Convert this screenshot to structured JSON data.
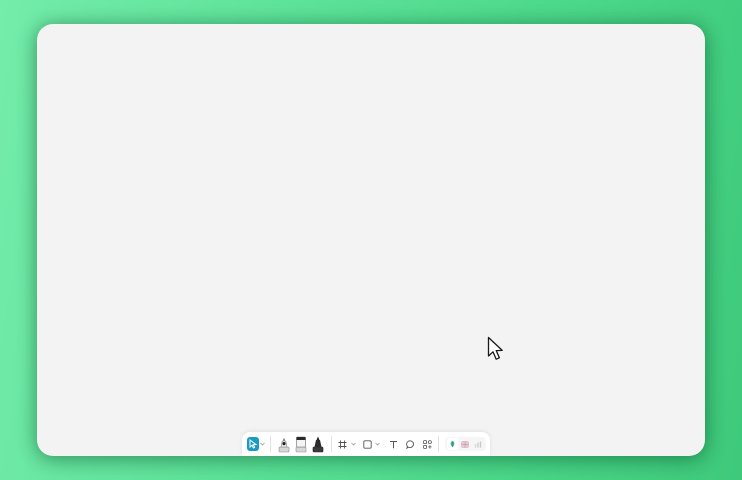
{
  "colors": {
    "background_start": "#74ecaa",
    "background_end": "#3ec97b",
    "canvas": "#f3f3f3",
    "toolbar": "#ffffff",
    "accent": "#1a9bc2"
  },
  "toolbar": {
    "tools": [
      {
        "id": "select",
        "icon": "pointer-icon",
        "active": true
      },
      {
        "id": "select-options",
        "icon": "chevron-down-icon"
      },
      {
        "id": "pen",
        "icon": "pen-icon"
      },
      {
        "id": "highlighter",
        "icon": "highlighter-icon"
      },
      {
        "id": "marker",
        "icon": "marker-icon"
      },
      {
        "id": "frame",
        "icon": "frame-icon"
      },
      {
        "id": "frame-options",
        "icon": "chevron-down-icon"
      },
      {
        "id": "shape",
        "icon": "square-icon"
      },
      {
        "id": "shape-options",
        "icon": "chevron-down-icon"
      },
      {
        "id": "text",
        "icon": "text-icon"
      },
      {
        "id": "comment",
        "icon": "speech-bubble-icon"
      },
      {
        "id": "components",
        "icon": "components-icon"
      },
      {
        "id": "widget-1",
        "icon": "leaf-widget-icon"
      },
      {
        "id": "widget-2",
        "icon": "grid-widget-icon"
      },
      {
        "id": "widget-3",
        "icon": "bars-widget-icon"
      }
    ]
  }
}
